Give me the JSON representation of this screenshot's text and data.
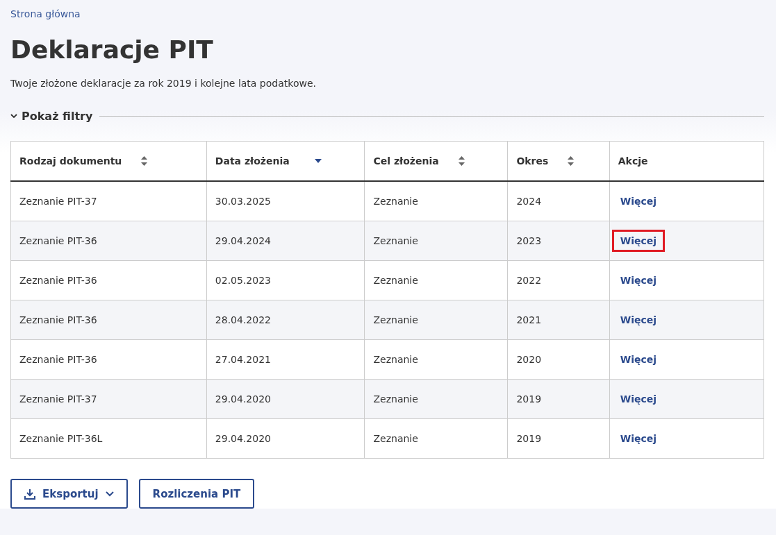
{
  "breadcrumb": "Strona główna",
  "title": "Deklaracje PIT",
  "description": "Twoje złożone deklaracje za rok 2019 i kolejne lata podatkowe.",
  "filters": {
    "label": "Pokaż filtry",
    "expanded": false
  },
  "table": {
    "columns": [
      {
        "label": "Rodzaj dokumentu",
        "sortable": true,
        "sorted": false
      },
      {
        "label": "Data złożenia",
        "sortable": true,
        "sorted": true
      },
      {
        "label": "Cel złożenia",
        "sortable": true,
        "sorted": false
      },
      {
        "label": "Okres",
        "sortable": true,
        "sorted": false
      },
      {
        "label": "Akcje",
        "sortable": false
      }
    ],
    "rows": [
      {
        "cells": [
          "Zeznanie PIT-37",
          "30.03.2025",
          "Zeznanie",
          "2024"
        ],
        "action": "Więcej",
        "highlighted": false
      },
      {
        "cells": [
          "Zeznanie PIT-36",
          "29.04.2024",
          "Zeznanie",
          "2023"
        ],
        "action": "Więcej",
        "highlighted": true
      },
      {
        "cells": [
          "Zeznanie PIT-36",
          "02.05.2023",
          "Zeznanie",
          "2022"
        ],
        "action": "Więcej",
        "highlighted": false
      },
      {
        "cells": [
          "Zeznanie PIT-36",
          "28.04.2022",
          "Zeznanie",
          "2021"
        ],
        "action": "Więcej",
        "highlighted": false
      },
      {
        "cells": [
          "Zeznanie PIT-36",
          "27.04.2021",
          "Zeznanie",
          "2020"
        ],
        "action": "Więcej",
        "highlighted": false
      },
      {
        "cells": [
          "Zeznanie PIT-37",
          "29.04.2020",
          "Zeznanie",
          "2019"
        ],
        "action": "Więcej",
        "highlighted": false
      },
      {
        "cells": [
          "Zeznanie PIT-36L",
          "29.04.2020",
          "Zeznanie",
          "2019"
        ],
        "action": "Więcej",
        "highlighted": false
      }
    ]
  },
  "buttons": [
    {
      "label": "Eksportuj",
      "kind": "dropdown"
    },
    {
      "label": "Rozliczenia PIT",
      "kind": "plain"
    }
  ]
}
